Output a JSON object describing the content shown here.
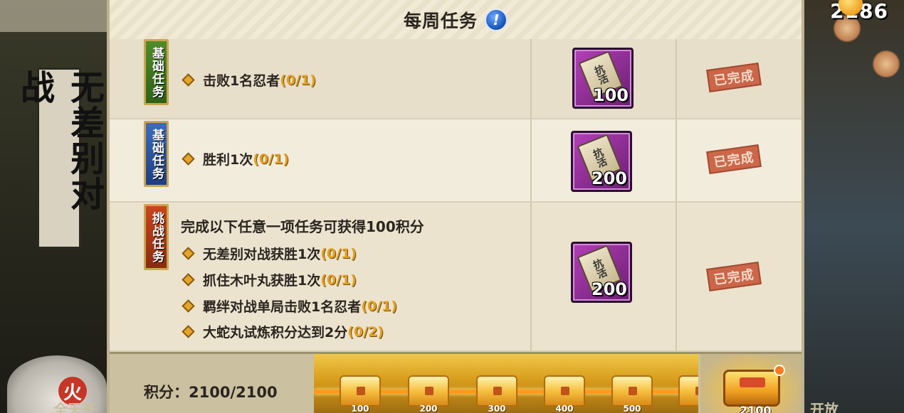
{
  "background": {
    "left_banner_text": "无差别对战",
    "left_bottom_text": "全天开",
    "right_bottom_text": "开放",
    "hat_symbol": "火"
  },
  "currency": {
    "icon": "gold-coin-icon",
    "amount": "2186"
  },
  "panel": {
    "title": "每周任务",
    "info_icon": "!"
  },
  "tasks": [
    {
      "category": "基础任务",
      "category_color": "#3f7a22",
      "items": [
        {
          "text": "击败1名忍者",
          "progress": "(0/1)"
        }
      ],
      "reward_amount": "100",
      "reward_ticket_text": "抗活",
      "status": "已完成"
    },
    {
      "category": "基础任务",
      "category_color": "#2c55a8",
      "items": [
        {
          "text": "胜利1次",
          "progress": "(0/1)"
        }
      ],
      "reward_amount": "200",
      "reward_ticket_text": "抗活",
      "status": "已完成"
    },
    {
      "category": "挑战任务",
      "category_color": "#b23a14",
      "description": "完成以下任意一项任务可获得100积分",
      "items": [
        {
          "text": "无差别对战获胜1次",
          "progress": "(0/1)"
        },
        {
          "text": "抓住木叶丸获胜1次",
          "progress": "(0/1)"
        },
        {
          "text": "羁绊对战单局击败1名忍者",
          "progress": "(0/1)"
        },
        {
          "text": "大蛇丸试炼积分达到2分",
          "progress": "(0/2)"
        }
      ],
      "reward_amount": "200",
      "reward_ticket_text": "抗活",
      "status": "已完成"
    }
  ],
  "score": {
    "label": "积分：",
    "value": "2100/2100"
  },
  "chests": [
    {
      "label": "100"
    },
    {
      "label": "200"
    },
    {
      "label": "300"
    },
    {
      "label": "400"
    },
    {
      "label": "500"
    }
  ],
  "final_chest": {
    "label": "2100"
  }
}
